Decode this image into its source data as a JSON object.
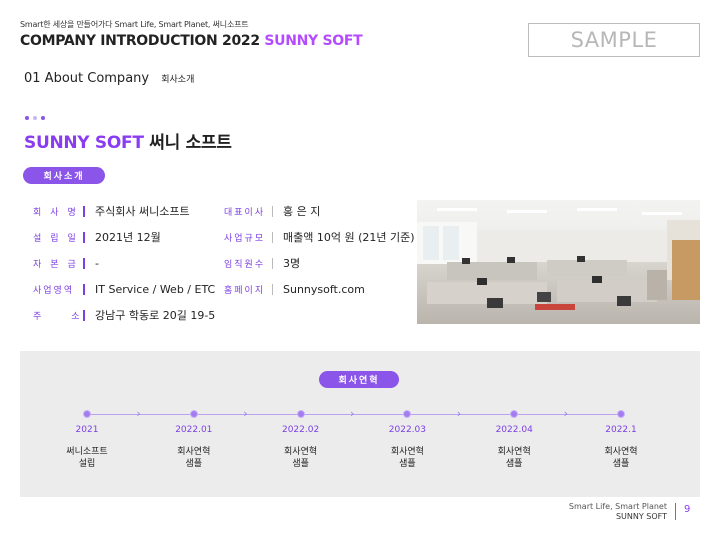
{
  "header": {
    "tagline": "Smart한 세상을 만들어가다 Smart Life, Smart Planet, 써니소프트",
    "title_main": "COMPANY INTRODUCTION 2022",
    "title_accent": "SUNNY SOFT",
    "sample_label": "SAMPLE"
  },
  "section": {
    "heading": "01 About Company",
    "sub": "회사소개"
  },
  "company": {
    "name_en": "SUNNY SOFT",
    "name_ko": "써니 소프트",
    "intro_label": "회사소개"
  },
  "info_left": [
    {
      "label": "회사명",
      "value": "주식회사 써니소프트"
    },
    {
      "label": "설립일",
      "value": "2021년 12월"
    },
    {
      "label": "자본금",
      "value": "-"
    },
    {
      "label": "사업영역",
      "value": "IT Service / Web / ETC"
    },
    {
      "label": "주소",
      "value": "강남구 학동로 20길 19-5"
    }
  ],
  "info_right": [
    {
      "label": "대표이사",
      "value": "홍 은 지"
    },
    {
      "label": "사업규모",
      "value": "매출액 10억 원 (21년 기준)"
    },
    {
      "label": "임직원수",
      "value": "3명"
    },
    {
      "label": "홈페이지",
      "value": "Sunnysoft.com"
    }
  ],
  "history": {
    "label": "회사연혁",
    "items": [
      {
        "date": "2021",
        "line1": "써니소프트",
        "line2": "설립"
      },
      {
        "date": "2022.01",
        "line1": "회사연혁",
        "line2": "샘플"
      },
      {
        "date": "2022.02",
        "line1": "회사연혁",
        "line2": "샘플"
      },
      {
        "date": "2022.03",
        "line1": "회사연혁",
        "line2": "샘플"
      },
      {
        "date": "2022.04",
        "line1": "회사연혁",
        "line2": "샘플"
      },
      {
        "date": "2022.1",
        "line1": "회사연혁",
        "line2": "샘플"
      }
    ]
  },
  "footer": {
    "line1": "Smart Life, Smart Planet",
    "line2": "SUNNY SOFT",
    "page_number": "9"
  },
  "colors": {
    "accent": "#8a3cf0",
    "pill": "#8a55e8",
    "title_accent": "#b44bff"
  }
}
